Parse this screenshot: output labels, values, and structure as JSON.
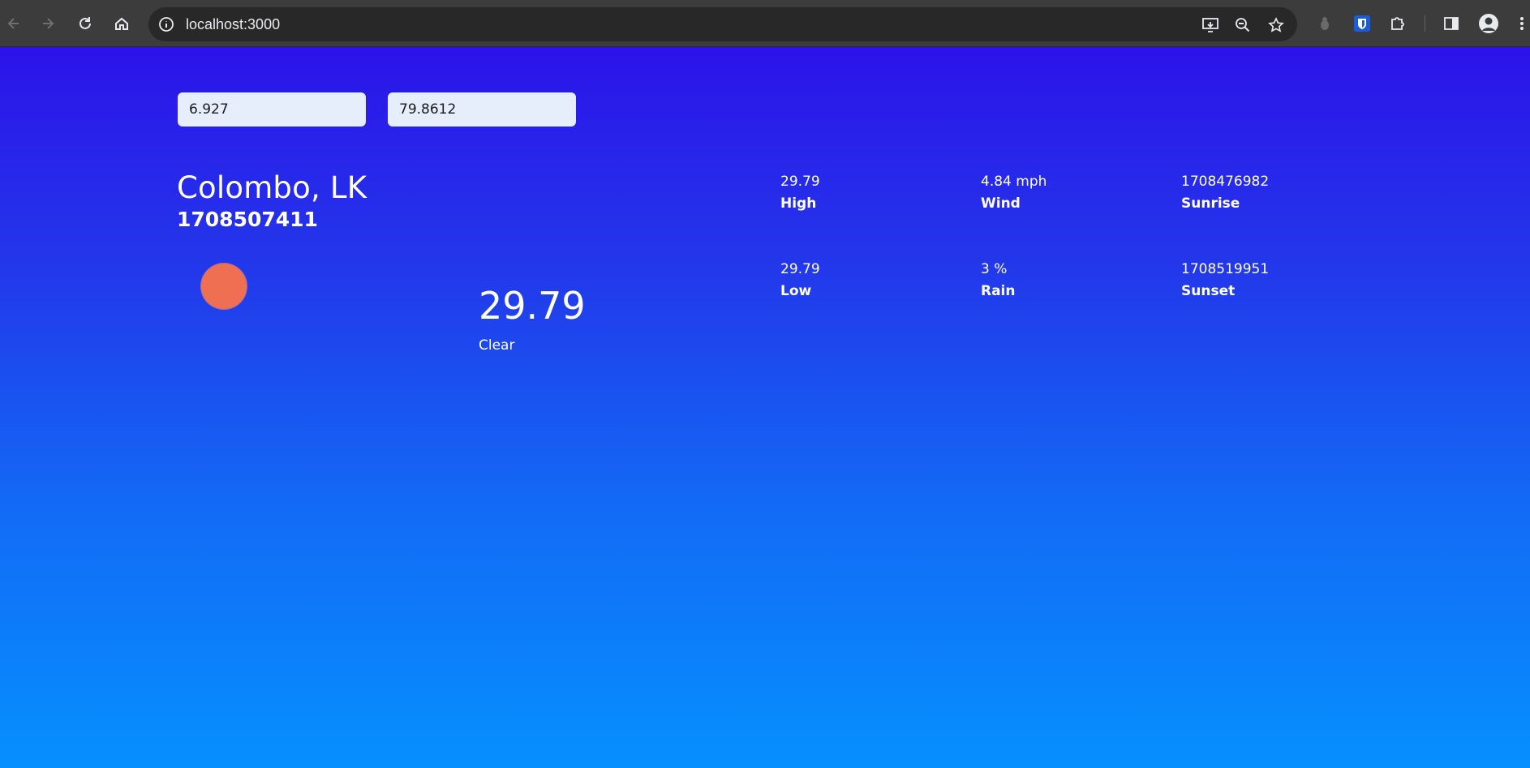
{
  "browser": {
    "url": "localhost:3000"
  },
  "inputs": {
    "latitude": "6.927",
    "longitude": "79.8612"
  },
  "location": {
    "city": "Colombo, LK",
    "datetime": "1708507411"
  },
  "current": {
    "icon": "sun-icon",
    "icon_color": "#ef6f52",
    "temperature": "29.79",
    "condition": "Clear"
  },
  "stats": {
    "high": {
      "value": "29.79",
      "label": "High"
    },
    "wind": {
      "value": "4.84 mph",
      "label": "Wind"
    },
    "sunrise": {
      "value": "1708476982",
      "label": "Sunrise"
    },
    "low": {
      "value": "29.79",
      "label": "Low"
    },
    "rain": {
      "value": "3 %",
      "label": "Rain"
    },
    "sunset": {
      "value": "1708519951",
      "label": "Sunset"
    }
  },
  "colors": {
    "gradient_top": "#2c13e9",
    "gradient_bottom": "#0690fe",
    "input_bg": "#e6eefb"
  }
}
